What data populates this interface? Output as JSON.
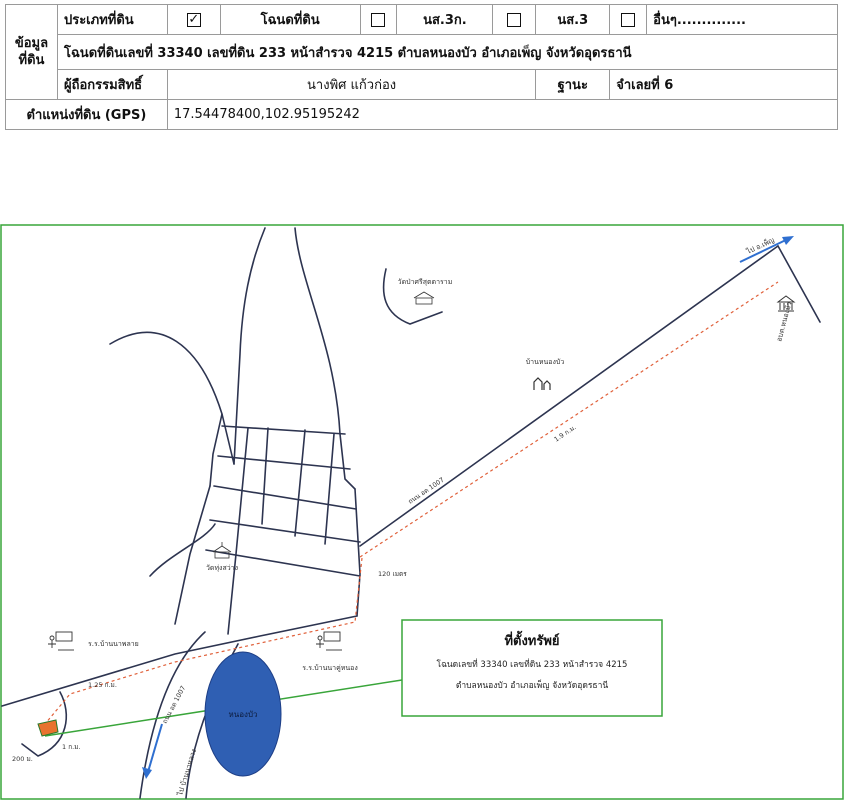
{
  "info_table": {
    "land_type_label": "ประเภทที่ดิน",
    "options": [
      {
        "label": "โฉนดที่ดิน",
        "checked": true
      },
      {
        "label": "นส.3ก.",
        "checked": false
      },
      {
        "label": "นส.3",
        "checked": false
      },
      {
        "label": "อื่นๆ..............",
        "checked": false
      }
    ],
    "checked_mark": "✓",
    "section_label_line1": "ข้อมูล",
    "section_label_line2": "ที่ดิน",
    "deed_text": "โฉนดที่ดินเลขที่ 33340 เลขที่ดิน 233 หน้าสำรวจ 4215 ตำบลหนองบัว อำเภอเพ็ญ จังหวัดอุดรธานี",
    "owner_label": "ผู้ถือกรรมสิทธิ์",
    "owner_value": "นางพิศ แก้วก่อง",
    "status_label": "ฐานะ",
    "status_value": "จำเลยที่ 6",
    "gps_label": "ตำแหน่งที่ดิน (GPS)",
    "gps_value": "17.54478400,102.95195242"
  },
  "map": {
    "temple_top_label": "วัดป่าศรีสุตตาราม",
    "village_label": "บ้านหนองบัว",
    "road_label_diag": "ถนน อด 1007",
    "dist_diag": "1.9 ก.ม.",
    "to_phen_label": "ไป อ.เพ็ญ",
    "district_office_label": "อบต.หนองบัว",
    "temple_mid_label": "วัดทุ่งสว่าง",
    "dist_120": "120 เมตร",
    "school_left_label": "ร.ร.บ้านนาพลาย",
    "school_right_label": "ร.ร.บ้านนาคู่หนอง",
    "dist_125": "1.25 ก.ม.",
    "dist_1": "1 ก.ม.",
    "dist_200": "200 ม.",
    "road_label_lower": "ถนน อด 1007",
    "to_left_label": "ไป บ้านนาหลวง",
    "pond_label": "หนองบัว",
    "callout_title": "ที่ตั้งทรัพย์",
    "callout_line1": "โฉนดเลขที่ 33340 เลขที่ดิน 233 หน้าสำรวจ 4215",
    "callout_line2": "ตำบลหนองบัว อำเภอเพ็ญ จังหวัดอุดรธานี"
  },
  "colors": {
    "frame": "#39a53a",
    "road": "#2d3450",
    "route": "#e0603a",
    "pond": "#2f5fb3",
    "arrow": "#2f6fd0",
    "property": "#e8732e"
  }
}
